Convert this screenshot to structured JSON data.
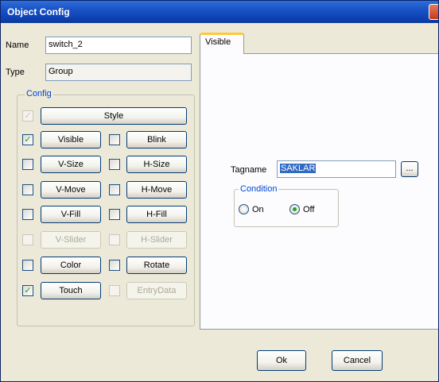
{
  "window": {
    "title": "Object Config"
  },
  "fields": {
    "name_label": "Name",
    "name_value": "switch_2",
    "type_label": "Type",
    "type_value": "Group"
  },
  "config": {
    "group_label": "Config",
    "style_label": "Style",
    "rows": [
      {
        "left": {
          "label": "Visible",
          "checked": true,
          "enabled": true
        },
        "right": {
          "label": "Blink",
          "checked": false,
          "enabled": true
        }
      },
      {
        "left": {
          "label": "V-Size",
          "checked": false,
          "enabled": true
        },
        "right": {
          "label": "H-Size",
          "checked": false,
          "enabled": true
        }
      },
      {
        "left": {
          "label": "V-Move",
          "checked": false,
          "enabled": true
        },
        "right": {
          "label": "H-Move",
          "checked": false,
          "enabled": true
        }
      },
      {
        "left": {
          "label": "V-Fill",
          "checked": false,
          "enabled": true
        },
        "right": {
          "label": "H-Fill",
          "checked": false,
          "enabled": true
        }
      },
      {
        "left": {
          "label": "V-Slider",
          "checked": false,
          "enabled": false
        },
        "right": {
          "label": "H-Slider",
          "checked": false,
          "enabled": false
        }
      },
      {
        "left": {
          "label": "Color",
          "checked": false,
          "enabled": true
        },
        "right": {
          "label": "Rotate",
          "checked": false,
          "enabled": true
        }
      },
      {
        "left": {
          "label": "Touch",
          "checked": true,
          "enabled": true
        },
        "right": {
          "label": "EntryData",
          "checked": false,
          "enabled": false
        }
      }
    ]
  },
  "tab": {
    "label": "Visible"
  },
  "visible_panel": {
    "tagname_label": "Tagname",
    "tagname_value": "SAKLAR",
    "browse_label": "...",
    "condition_label": "Condition",
    "on_label": "On",
    "off_label": "Off",
    "selected": "Off"
  },
  "buttons": {
    "ok": "Ok",
    "cancel": "Cancel"
  },
  "colors": {
    "title_bar": "#0f45b8",
    "group_title": "#0046d5",
    "selection": "#316ac5",
    "check": "#21a121"
  }
}
